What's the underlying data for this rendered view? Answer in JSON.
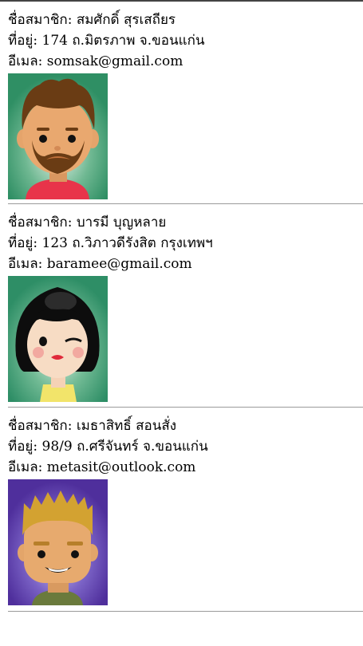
{
  "labels": {
    "name": "ชื่อสมาชิก:",
    "address": "ที่อยู่:",
    "email": "อีเมล:"
  },
  "members": [
    {
      "name": "สมศักดิ์ สุรเสถียร",
      "address": "174 ถ.มิตรภาพ จ.ขอนแก่น",
      "email": "somsak@gmail.com",
      "avatar_icon": "bearded-man-avatar"
    },
    {
      "name": "บารมี บุญหลาย",
      "address": "123 ถ.วิภาวดีรังสิต กรุงเทพฯ",
      "email": "baramee@gmail.com",
      "avatar_icon": "winking-woman-avatar"
    },
    {
      "name": "เมธาสิทธิ์ สอนสั่ง",
      "address": "98/9 ถ.ศรีจันทร์ จ.ขอนแก่น",
      "email": "metasit@outlook.com",
      "avatar_icon": "blond-man-avatar"
    }
  ],
  "colors": {
    "avatar1_bg": "#3f9a72",
    "avatar2_bg": "#3c9a78",
    "avatar3_bg": "#5533a0",
    "divider": "#9a9a9a"
  }
}
